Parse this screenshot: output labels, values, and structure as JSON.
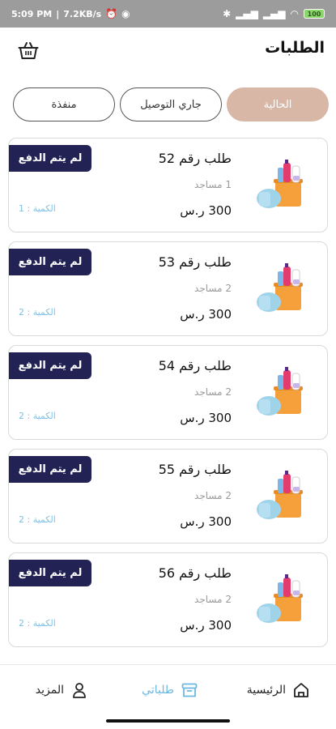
{
  "status_bar": {
    "time": "5:09 PM",
    "speed": "7.2KB/s",
    "battery": "100"
  },
  "header": {
    "title": "الطلبات",
    "basket_icon": "basket-icon"
  },
  "tabs": [
    {
      "label": "الحالية",
      "active": true
    },
    {
      "label": "جاري التوصيل",
      "active": false
    },
    {
      "label": "منفذة",
      "active": false
    }
  ],
  "orders": [
    {
      "title": "طلب رقم 52",
      "count": "1 مساجد",
      "price": "300 ر.س",
      "qty": "الكمية : 1",
      "badge": "لم يتم الدفع"
    },
    {
      "title": "طلب رقم 53",
      "count": "2 مساجد",
      "price": "300 ر.س",
      "qty": "الكمية : 2",
      "badge": "لم يتم الدفع"
    },
    {
      "title": "طلب رقم 54",
      "count": "2 مساجد",
      "price": "300 ر.س",
      "qty": "الكمية : 2",
      "badge": "لم يتم الدفع"
    },
    {
      "title": "طلب رقم 55",
      "count": "2 مساجد",
      "price": "300 ر.س",
      "qty": "الكمية : 2",
      "badge": "لم يتم الدفع"
    },
    {
      "title": "طلب رقم 56",
      "count": "2 مساجد",
      "price": "300 ر.س",
      "qty": "الكمية : 2",
      "badge": "لم يتم الدفع"
    }
  ],
  "bottom_nav": {
    "home": "الرئيسية",
    "orders": "طلباتي",
    "more": "المزيد"
  },
  "colors": {
    "badge": "#222255",
    "tab_active": "#d8b7a7",
    "accent": "#6cb8df"
  }
}
